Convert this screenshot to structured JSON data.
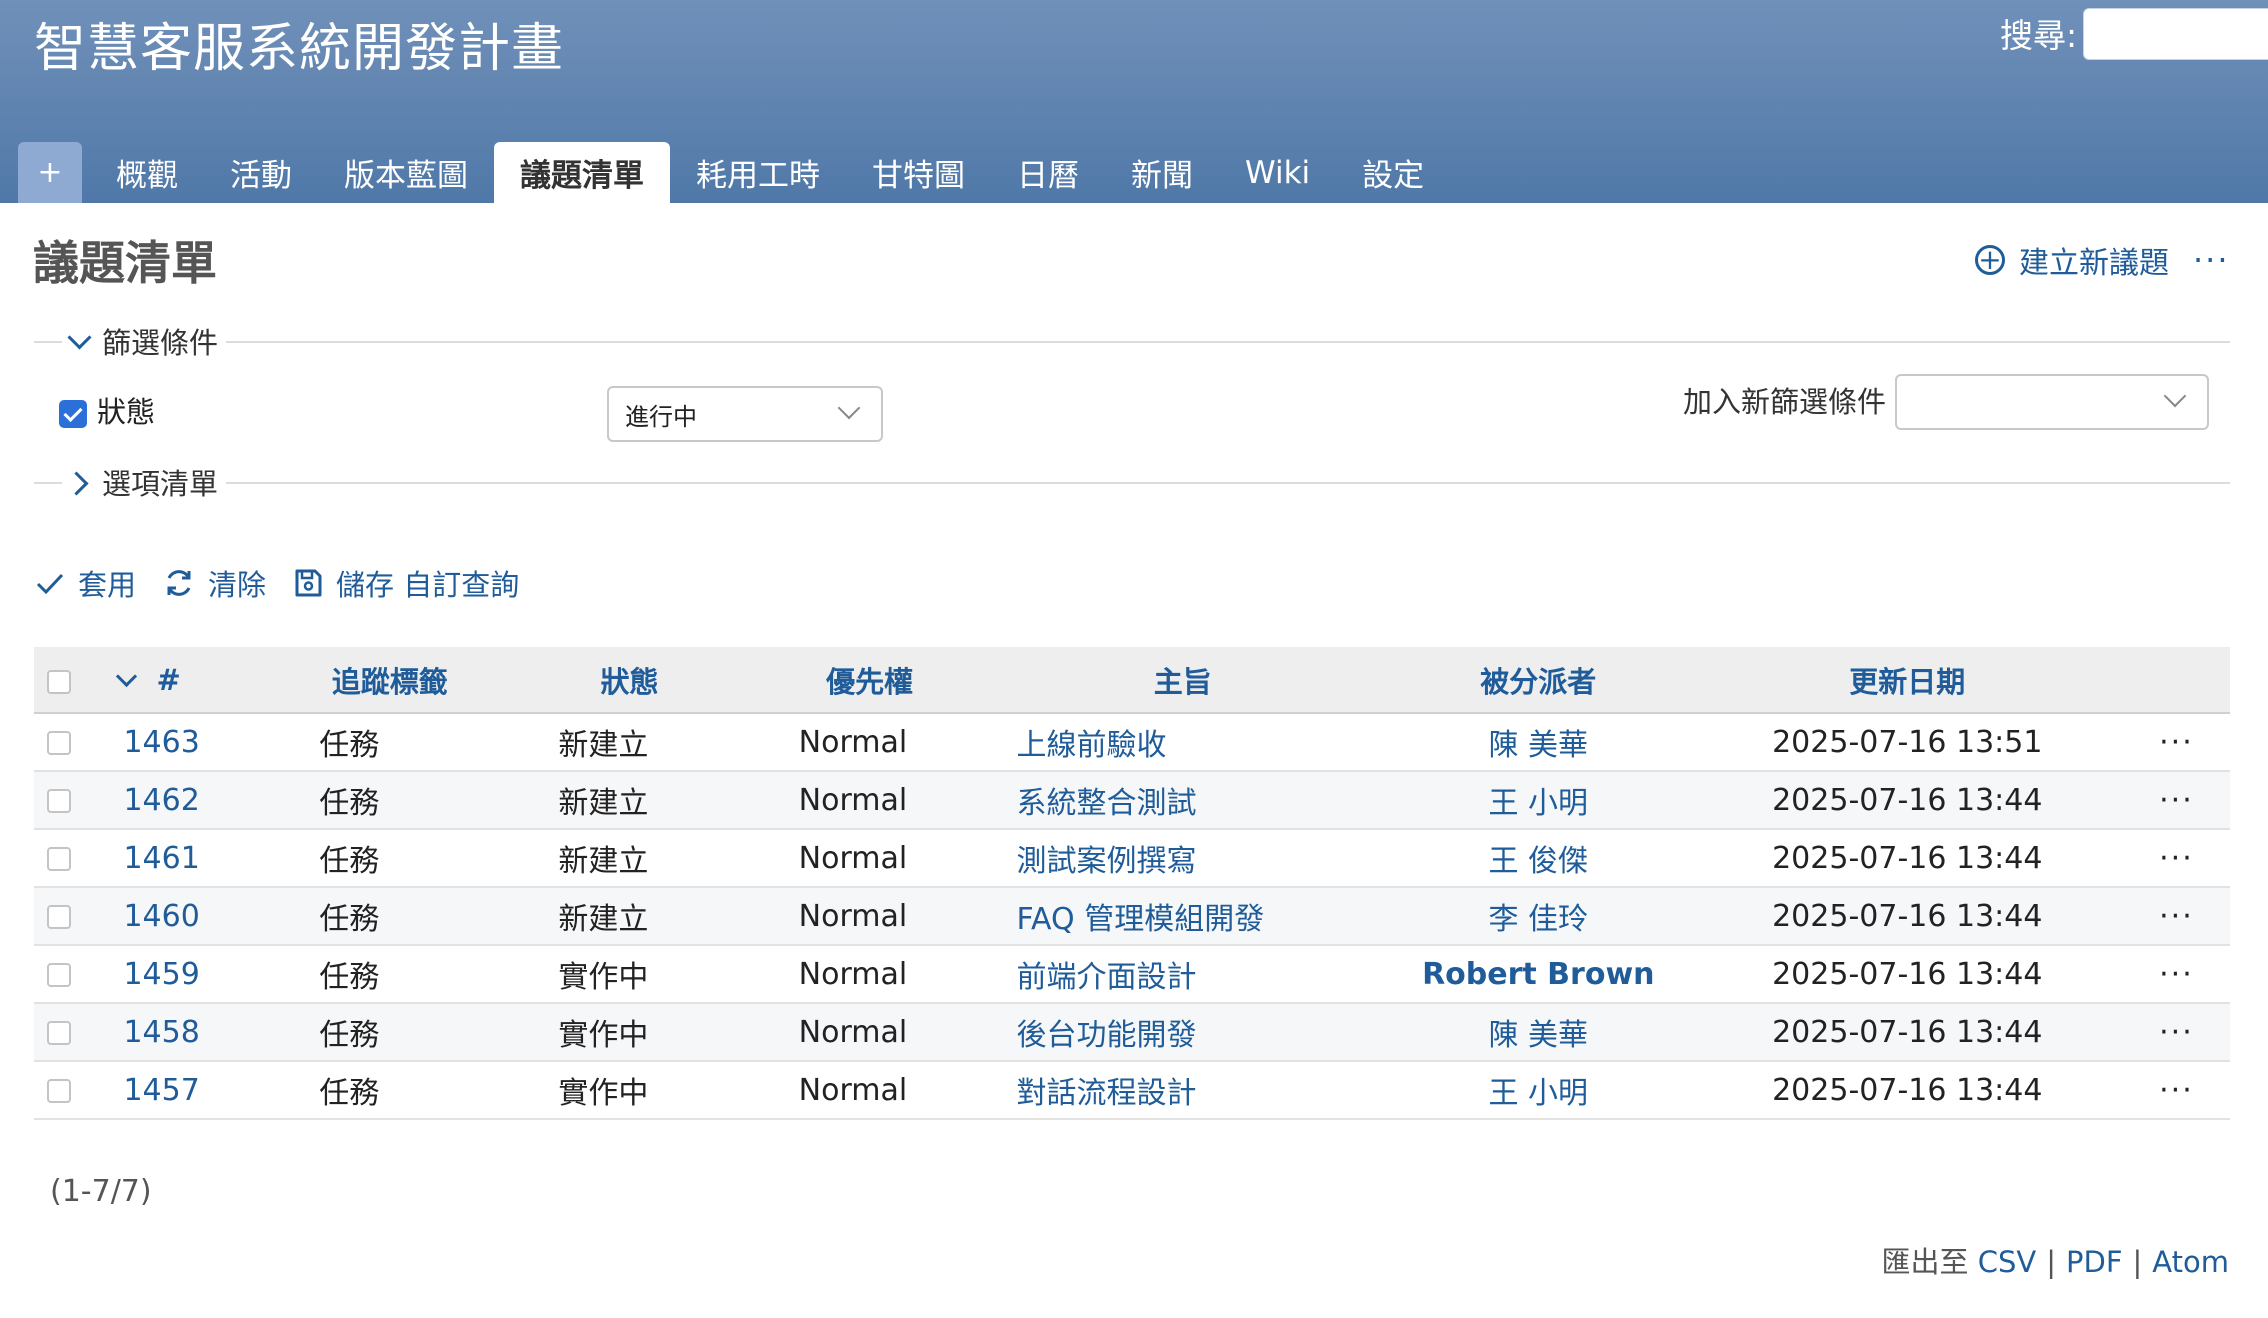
{
  "header": {
    "project_title": "智慧客服系統開發計畫",
    "search_label": "搜尋:",
    "search_value": ""
  },
  "menu": {
    "plus": "+",
    "tabs": [
      "概觀",
      "活動",
      "版本藍圖",
      "議題清單",
      "耗用工時",
      "甘特圖",
      "日曆",
      "新聞",
      "Wiki",
      "設定"
    ],
    "selected": "議題清單"
  },
  "page": {
    "title": "議題清單",
    "new_issue": "建立新議題",
    "more": "···"
  },
  "filters": {
    "legend": "篩選條件",
    "status_label": "狀態",
    "status_checked": true,
    "status_value": "進行中",
    "add_filter_label": "加入新篩選條件",
    "add_filter_value": ""
  },
  "options": {
    "legend": "選項清單"
  },
  "buttons": {
    "apply": "套用",
    "clear": "清除",
    "save": "儲存 自訂查詢"
  },
  "table": {
    "columns": {
      "id": "#",
      "tracker": "追蹤標籤",
      "status": "狀態",
      "priority": "優先權",
      "subject": "主旨",
      "assignee": "被分派者",
      "updated": "更新日期"
    },
    "rows": [
      {
        "id": "1463",
        "tracker": "任務",
        "status": "新建立",
        "priority": "Normal",
        "subject": "上線前驗收",
        "assignee": "陳 美華",
        "updated": "2025-07-16 13:51",
        "more": "···"
      },
      {
        "id": "1462",
        "tracker": "任務",
        "status": "新建立",
        "priority": "Normal",
        "subject": "系統整合測試",
        "assignee": "王 小明",
        "updated": "2025-07-16 13:44",
        "more": "···"
      },
      {
        "id": "1461",
        "tracker": "任務",
        "status": "新建立",
        "priority": "Normal",
        "subject": "測試案例撰寫",
        "assignee": "王 俊傑",
        "updated": "2025-07-16 13:44",
        "more": "···"
      },
      {
        "id": "1460",
        "tracker": "任務",
        "status": "新建立",
        "priority": "Normal",
        "subject": "FAQ 管理模組開發",
        "assignee": "李 佳玲",
        "updated": "2025-07-16 13:44",
        "more": "···"
      },
      {
        "id": "1459",
        "tracker": "任務",
        "status": "實作中",
        "priority": "Normal",
        "subject": "前端介面設計",
        "assignee": "Robert Brown",
        "updated": "2025-07-16 13:44",
        "more": "···"
      },
      {
        "id": "1458",
        "tracker": "任務",
        "status": "實作中",
        "priority": "Normal",
        "subject": "後台功能開發",
        "assignee": "陳 美華",
        "updated": "2025-07-16 13:44",
        "more": "···"
      },
      {
        "id": "1457",
        "tracker": "任務",
        "status": "實作中",
        "priority": "Normal",
        "subject": "對話流程設計",
        "assignee": "王 小明",
        "updated": "2025-07-16 13:44",
        "more": "···"
      }
    ]
  },
  "pagination": "(1-7/7)",
  "export": {
    "label": "匯出至",
    "csv": "CSV",
    "pdf": "PDF",
    "atom": "Atom",
    "separator": "|"
  },
  "colors": {
    "header_gradient_top": "#6f90b9",
    "header_gradient_bottom": "#4f78a8",
    "link": "#1f5c99",
    "checkbox_checked": "#2b6fd8"
  }
}
